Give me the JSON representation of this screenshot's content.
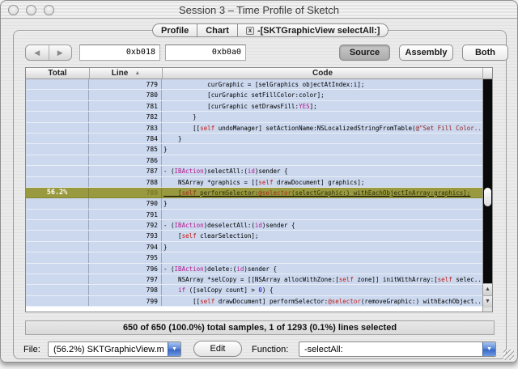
{
  "window": {
    "title": "Session 3 – Time Profile of Sketch"
  },
  "tabs": [
    {
      "label": "Profile"
    },
    {
      "label": "Chart"
    },
    {
      "label": "-[SKTGraphicView selectAll:]",
      "closable": true
    }
  ],
  "icons": {
    "back": "◀",
    "forward": "▶",
    "sort_ascending": "▲",
    "popup_arrow": "▼",
    "tab_close": "x",
    "scroll_up": "▲",
    "scroll_down": "▼"
  },
  "toolbar": {
    "address1": "0xb018",
    "address2": "0xb0a0",
    "view_buttons": [
      {
        "label": "Source",
        "selected": true
      },
      {
        "label": "Assembly",
        "selected": false
      },
      {
        "label": "Both",
        "selected": false
      }
    ]
  },
  "table": {
    "columns": [
      "Total",
      "Line",
      "Code"
    ],
    "rows": [
      {
        "total": "",
        "line": "779",
        "hl": false,
        "code": [
          {
            "t": "            curGraphic = [selGraphics objectAtIndex:i];",
            "c": "p"
          }
        ]
      },
      {
        "total": "",
        "line": "780",
        "hl": false,
        "code": [
          {
            "t": "            [curGraphic setFillColor:color];",
            "c": "p"
          }
        ]
      },
      {
        "total": "",
        "line": "781",
        "hl": false,
        "code": [
          {
            "t": "            [curGraphic setDrawsFill:",
            "c": "p"
          },
          {
            "t": "YES",
            "c": "k"
          },
          {
            "t": "];",
            "c": "p"
          }
        ]
      },
      {
        "total": "",
        "line": "782",
        "hl": false,
        "code": [
          {
            "t": "        }",
            "c": "p"
          }
        ]
      },
      {
        "total": "",
        "line": "783",
        "hl": false,
        "code": [
          {
            "t": "        [[",
            "c": "p"
          },
          {
            "t": "self",
            "c": "r"
          },
          {
            "t": " undoManager] setActionName:NSLocalizedStringFromTable(",
            "c": "p"
          },
          {
            "t": "@\"Set Fill Color...",
            "c": "s"
          }
        ]
      },
      {
        "total": "",
        "line": "784",
        "hl": false,
        "code": [
          {
            "t": "    }",
            "c": "p"
          }
        ]
      },
      {
        "total": "",
        "line": "785",
        "hl": false,
        "code": [
          {
            "t": "}",
            "c": "p"
          }
        ]
      },
      {
        "total": "",
        "line": "786",
        "hl": false,
        "code": []
      },
      {
        "total": "",
        "line": "787",
        "hl": false,
        "code": [
          {
            "t": "- (",
            "c": "p"
          },
          {
            "t": "IBAction",
            "c": "k"
          },
          {
            "t": ")selectAll:(",
            "c": "p"
          },
          {
            "t": "id",
            "c": "k"
          },
          {
            "t": ")sender {",
            "c": "p"
          }
        ]
      },
      {
        "total": "",
        "line": "788",
        "hl": false,
        "code": [
          {
            "t": "    NSArray *graphics = [[",
            "c": "p"
          },
          {
            "t": "self",
            "c": "r"
          },
          {
            "t": " drawDocument] graphics];",
            "c": "p"
          }
        ]
      },
      {
        "total": "56.2%",
        "line": "789",
        "hl": true,
        "code": [
          {
            "t": "    [",
            "c": "p"
          },
          {
            "t": "self",
            "c": "r"
          },
          {
            "t": " performSelector:",
            "c": "p"
          },
          {
            "t": "@selector",
            "c": "r"
          },
          {
            "t": "(selectGraphic:) withEachObjectInArray:graphics];",
            "c": "p"
          }
        ]
      },
      {
        "total": "",
        "line": "790",
        "hl": false,
        "code": [
          {
            "t": "}",
            "c": "p"
          }
        ]
      },
      {
        "total": "",
        "line": "791",
        "hl": false,
        "code": []
      },
      {
        "total": "",
        "line": "792",
        "hl": false,
        "code": [
          {
            "t": "- (",
            "c": "p"
          },
          {
            "t": "IBAction",
            "c": "k"
          },
          {
            "t": ")deselectAll:(",
            "c": "p"
          },
          {
            "t": "id",
            "c": "k"
          },
          {
            "t": ")sender {",
            "c": "p"
          }
        ]
      },
      {
        "total": "",
        "line": "793",
        "hl": false,
        "code": [
          {
            "t": "    [",
            "c": "p"
          },
          {
            "t": "self",
            "c": "r"
          },
          {
            "t": " clearSelection];",
            "c": "p"
          }
        ]
      },
      {
        "total": "",
        "line": "794",
        "hl": false,
        "code": [
          {
            "t": "}",
            "c": "p"
          }
        ]
      },
      {
        "total": "",
        "line": "795",
        "hl": false,
        "code": []
      },
      {
        "total": "",
        "line": "796",
        "hl": false,
        "code": [
          {
            "t": "- (",
            "c": "p"
          },
          {
            "t": "IBAction",
            "c": "k"
          },
          {
            "t": ")delete:(",
            "c": "p"
          },
          {
            "t": "id",
            "c": "k"
          },
          {
            "t": ")sender {",
            "c": "p"
          }
        ]
      },
      {
        "total": "",
        "line": "797",
        "hl": false,
        "code": [
          {
            "t": "    NSArray *selCopy = [[NSArray allocWithZone:[",
            "c": "p"
          },
          {
            "t": "self",
            "c": "r"
          },
          {
            "t": " zone]] initWithArray:[",
            "c": "p"
          },
          {
            "t": "self",
            "c": "r"
          },
          {
            "t": " selec...",
            "c": "p"
          }
        ]
      },
      {
        "total": "",
        "line": "798",
        "hl": false,
        "code": [
          {
            "t": "    ",
            "c": "p"
          },
          {
            "t": "if",
            "c": "k"
          },
          {
            "t": " ([selCopy count] > ",
            "c": "p"
          },
          {
            "t": "0",
            "c": "n"
          },
          {
            "t": ") {",
            "c": "p"
          }
        ]
      },
      {
        "total": "",
        "line": "799",
        "hl": false,
        "code": [
          {
            "t": "        [[",
            "c": "p"
          },
          {
            "t": "self",
            "c": "r"
          },
          {
            "t": " drawDocument] performSelector:",
            "c": "p"
          },
          {
            "t": "@selector",
            "c": "r"
          },
          {
            "t": "(removeGraphic:) withEachObject...",
            "c": "p"
          }
        ]
      }
    ]
  },
  "status": "650 of 650 (100.0%) total samples, 1 of 1293 (0.1%) lines selected",
  "footer": {
    "file_label": "File:",
    "file_value": "(56.2%) SKTGraphicView.m",
    "edit_label": "Edit",
    "function_label": "Function:",
    "function_value": "-selectAll:"
  },
  "colors": {
    "accent_popup_blue": "#5E8BD5",
    "row_blue": "#CBD8EE",
    "highlight_olive": "#99993F",
    "keyword_magenta": "#B5178C",
    "self_red": "#C41A16",
    "string_dark_red": "#962121",
    "number_blue": "#1C00CF"
  }
}
